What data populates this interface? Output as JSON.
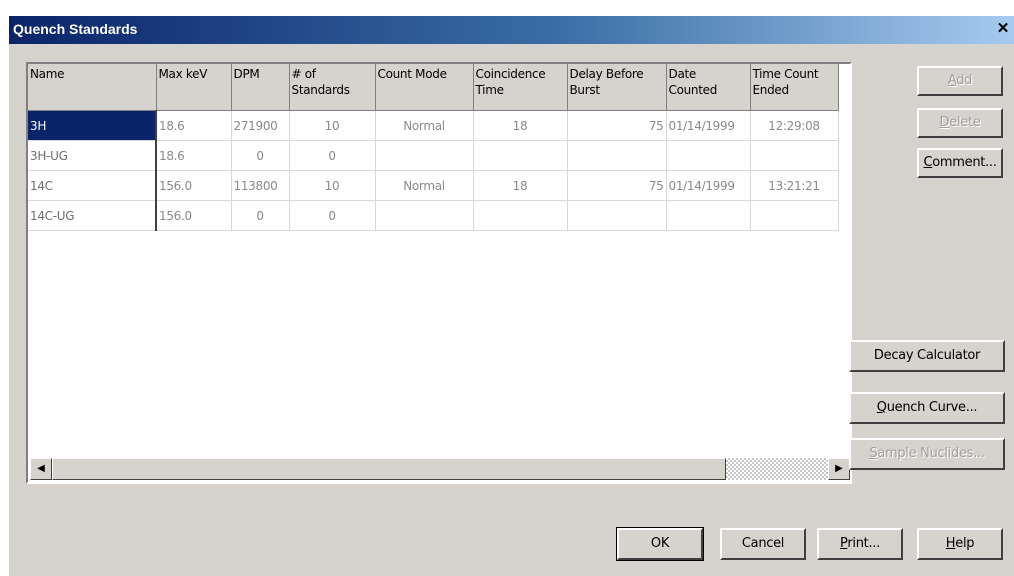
{
  "window": {
    "title": "Quench Standards",
    "close_glyph": "✕"
  },
  "table": {
    "columns": [
      "Name",
      "Max keV",
      "DPM",
      "# of Standards",
      "Count Mode",
      "Coincidence Time",
      "Delay Before Burst",
      "Date Counted",
      "Time Count Ended"
    ],
    "rows": [
      [
        "3H",
        "18.6",
        "271900",
        "10",
        "Normal",
        "18",
        "75",
        "01/14/1999",
        "12:29:08"
      ],
      [
        "3H-UG",
        "18.6",
        "0",
        "0",
        "",
        "",
        "",
        "",
        ""
      ],
      [
        "14C",
        "156.0",
        "113800",
        "10",
        "Normal",
        "18",
        "75",
        "01/14/1999",
        "13:21:21"
      ],
      [
        "14C-UG",
        "156.0",
        "0",
        "0",
        "",
        "",
        "",
        "",
        ""
      ]
    ],
    "selected_row": 0
  },
  "buttons": {
    "add": {
      "first": "A",
      "rest": "dd"
    },
    "delete": {
      "first": "D",
      "rest": "elete"
    },
    "comment": {
      "first": "C",
      "rest": "omment..."
    },
    "decay_calculator": {
      "label": "Decay Calculator"
    },
    "quench_curve": {
      "first": "Q",
      "rest": "uench Curve..."
    },
    "sample_nuclides": {
      "first": "S",
      "rest": "ample Nuclides..."
    },
    "ok": {
      "label": "OK"
    },
    "cancel": {
      "label": "Cancel"
    },
    "print": {
      "first": "P",
      "rest": "rint..."
    },
    "help": {
      "first": "H",
      "rest": "elp"
    }
  },
  "scrollbar": {
    "left_arrow": "◀",
    "right_arrow": "▶"
  },
  "icons": {
    "close": "close-icon",
    "scroll_left": "scroll-left-arrow-icon",
    "scroll_right": "scroll-right-arrow-icon"
  }
}
